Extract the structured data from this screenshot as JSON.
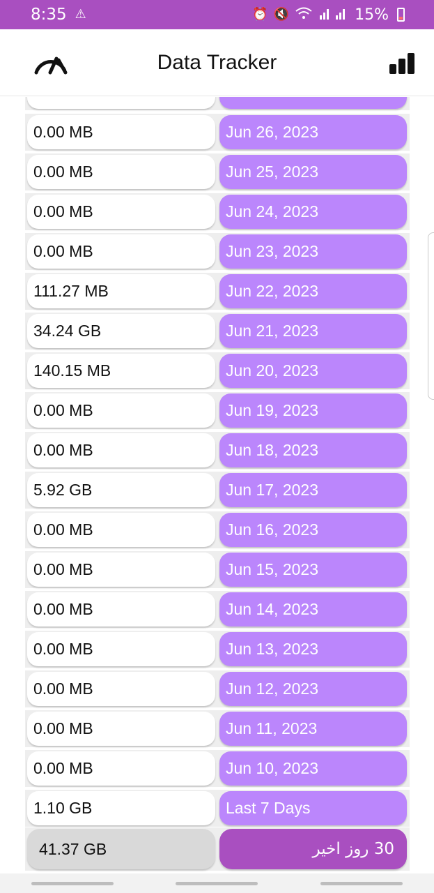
{
  "status": {
    "time": "8:35",
    "battery": "15%",
    "warning_icon": "warning-icon",
    "alarm_icon": "alarm-icon",
    "mute_icon": "mute-icon",
    "wifi_icon": "wifi-icon",
    "signal_icon": "signal-icon",
    "battery_icon": "battery-icon"
  },
  "app": {
    "title": "Data Tracker",
    "left_icon": "gauge-icon",
    "right_icon": "bar-chart-icon",
    "accent": "#bb86fc",
    "brand": "#a94fc0"
  },
  "rows": [
    {
      "usage": "0.00 MB",
      "date": "Jun 26, 2023"
    },
    {
      "usage": "0.00 MB",
      "date": "Jun 25, 2023"
    },
    {
      "usage": "0.00 MB",
      "date": "Jun 24, 2023"
    },
    {
      "usage": "0.00 MB",
      "date": "Jun 23, 2023"
    },
    {
      "usage": "111.27 MB",
      "date": "Jun 22, 2023"
    },
    {
      "usage": "34.24 GB",
      "date": "Jun 21, 2023"
    },
    {
      "usage": "140.15 MB",
      "date": "Jun 20, 2023"
    },
    {
      "usage": "0.00 MB",
      "date": "Jun 19, 2023"
    },
    {
      "usage": "0.00 MB",
      "date": "Jun 18, 2023"
    },
    {
      "usage": "5.92 GB",
      "date": "Jun 17, 2023"
    },
    {
      "usage": "0.00 MB",
      "date": "Jun 16, 2023"
    },
    {
      "usage": "0.00 MB",
      "date": "Jun 15, 2023"
    },
    {
      "usage": "0.00 MB",
      "date": "Jun 14, 2023"
    },
    {
      "usage": "0.00 MB",
      "date": "Jun 13, 2023"
    },
    {
      "usage": "0.00 MB",
      "date": "Jun 12, 2023"
    },
    {
      "usage": "0.00 MB",
      "date": "Jun 11, 2023"
    },
    {
      "usage": "0.00 MB",
      "date": "Jun 10, 2023"
    }
  ],
  "last7": {
    "usage": "1.10 GB",
    "label": "Last 7 Days"
  },
  "last30": {
    "usage": "41.37 GB",
    "label": "30 روز اخیر"
  }
}
